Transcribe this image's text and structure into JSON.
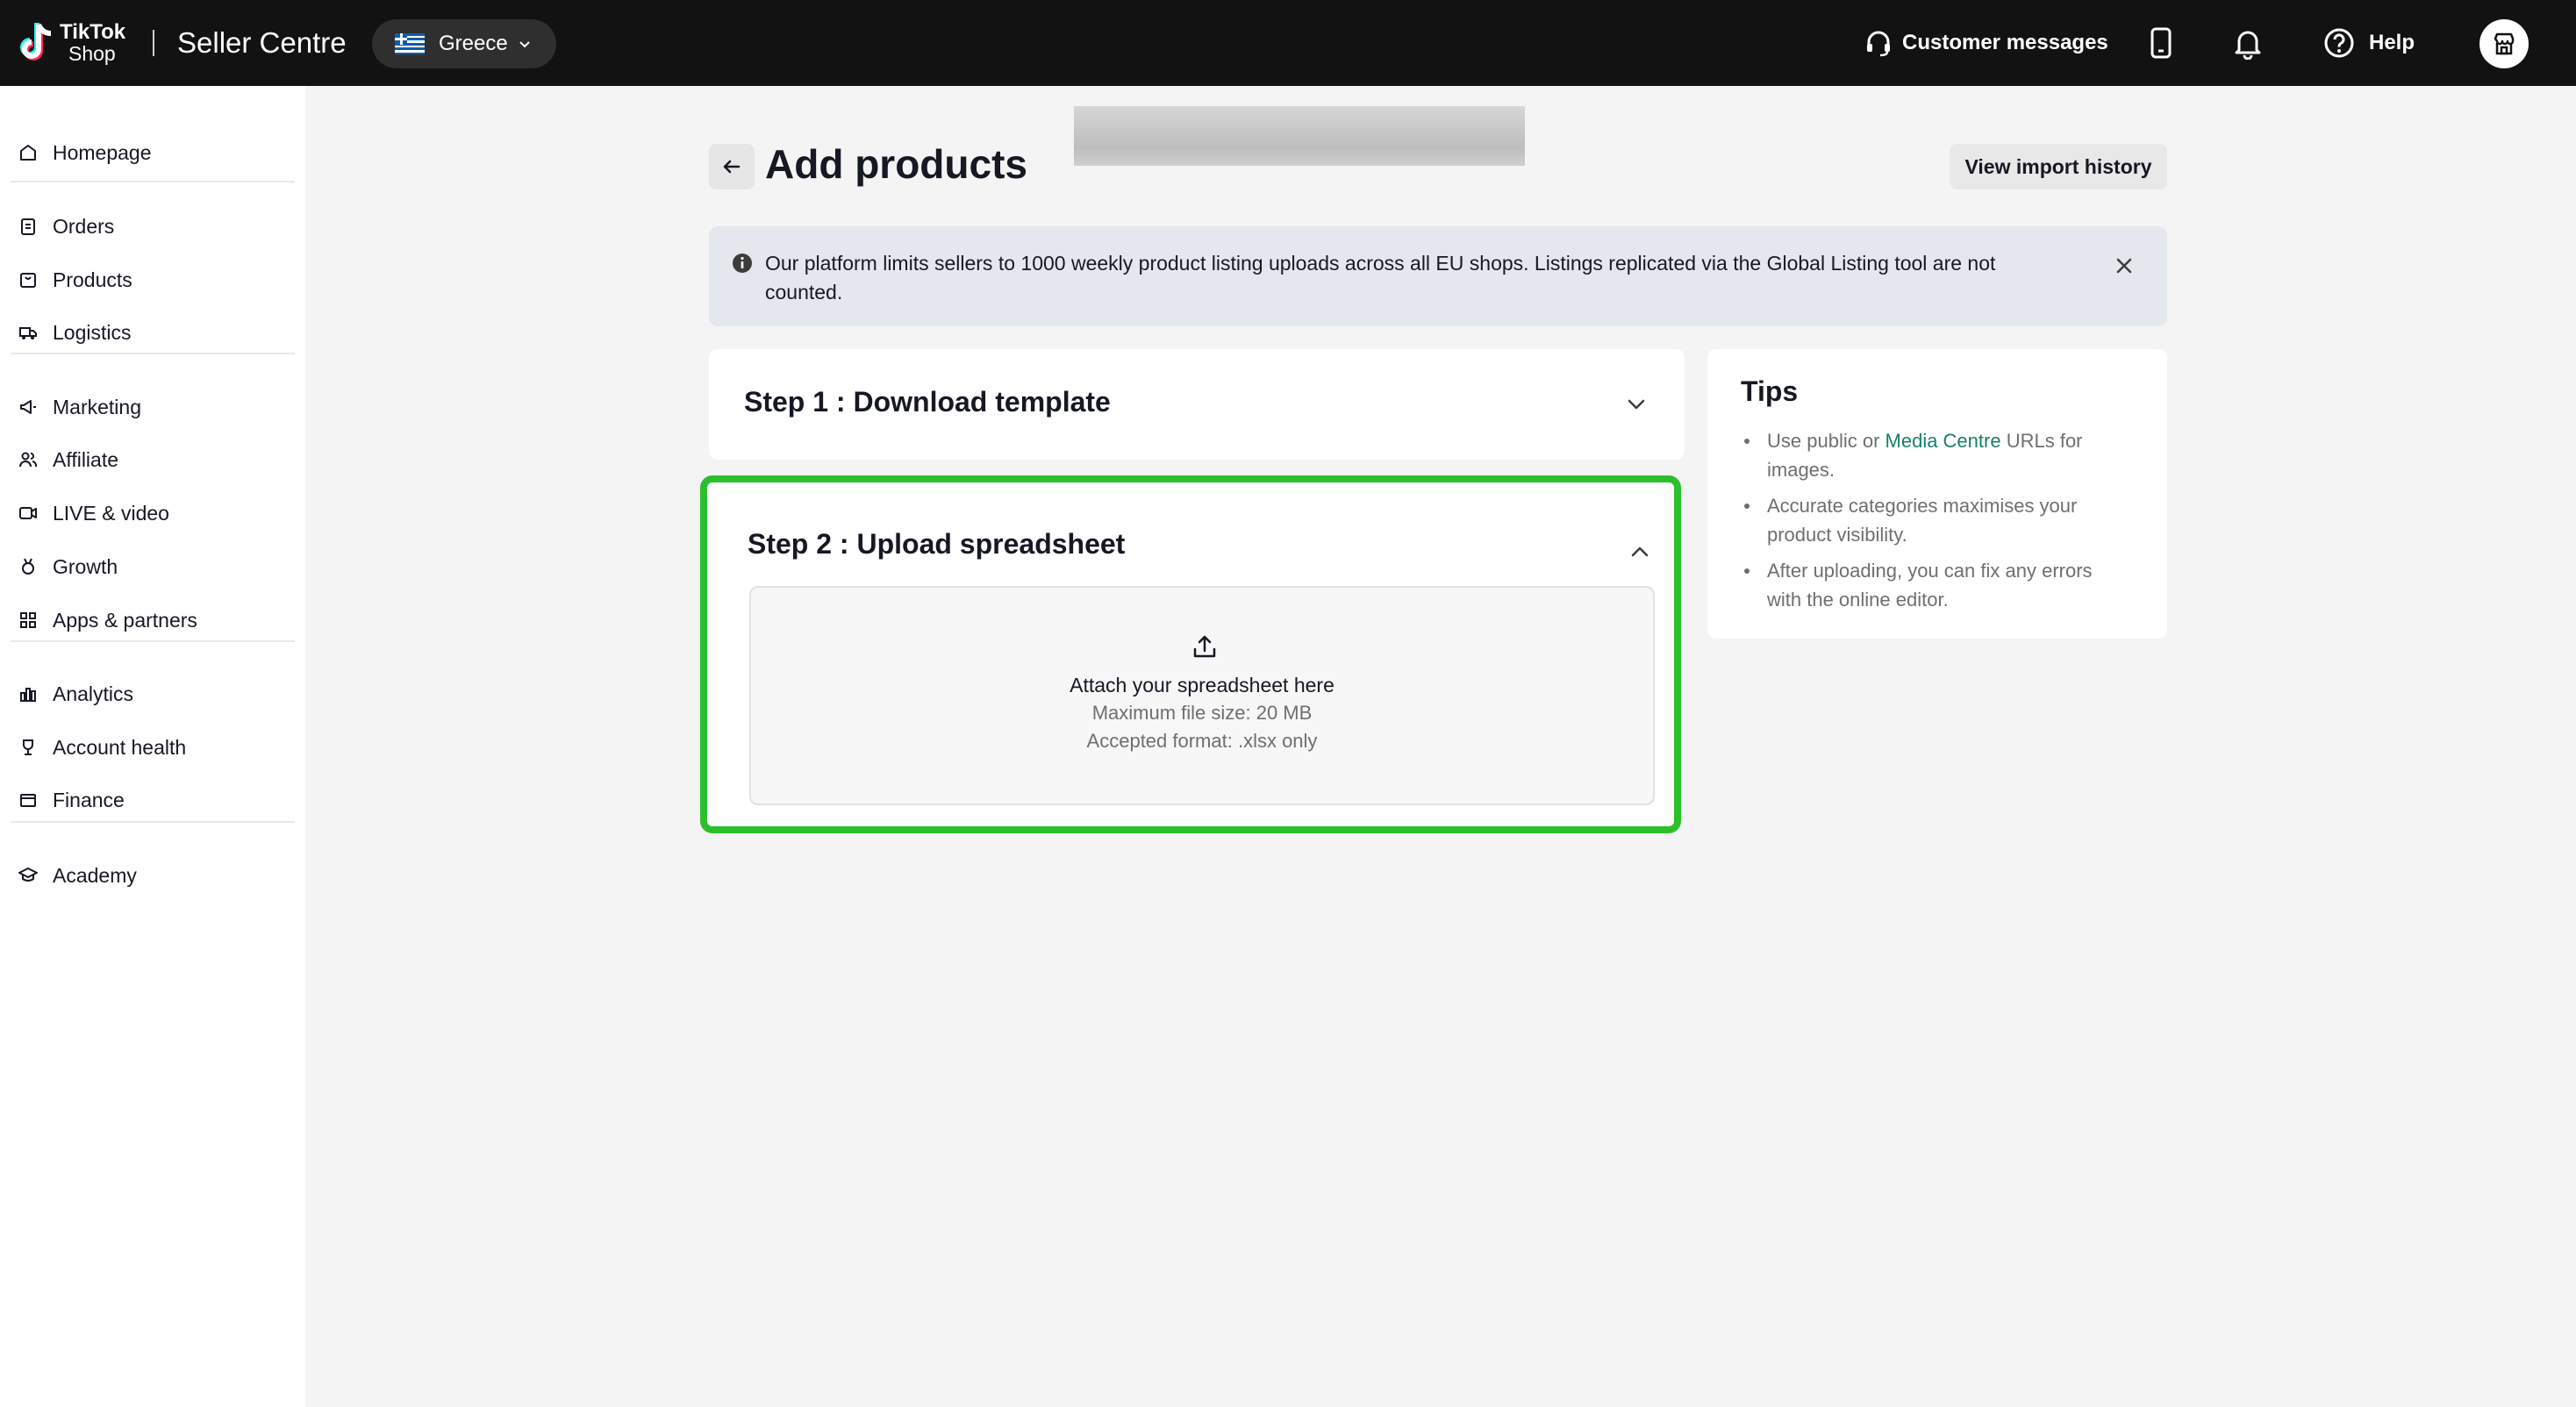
{
  "topbar": {
    "logo_line1": "TikTok",
    "logo_line2": "Shop",
    "app_title": "Seller Centre",
    "region": "Greece",
    "customer_messages": "Customer messages",
    "help": "Help"
  },
  "sidebar": {
    "items": [
      {
        "label": "Homepage",
        "icon": "home-icon"
      },
      {
        "label": "Orders",
        "icon": "clipboard-icon"
      },
      {
        "label": "Products",
        "icon": "box-icon"
      },
      {
        "label": "Logistics",
        "icon": "truck-icon"
      },
      {
        "label": "Marketing",
        "icon": "megaphone-icon"
      },
      {
        "label": "Affiliate",
        "icon": "users-icon"
      },
      {
        "label": "LIVE & video",
        "icon": "video-icon"
      },
      {
        "label": "Growth",
        "icon": "medal-icon"
      },
      {
        "label": "Apps & partners",
        "icon": "grid-icon"
      },
      {
        "label": "Analytics",
        "icon": "chart-icon"
      },
      {
        "label": "Account health",
        "icon": "trophy-icon"
      },
      {
        "label": "Finance",
        "icon": "wallet-icon"
      },
      {
        "label": "Academy",
        "icon": "graduation-cap-icon"
      }
    ]
  },
  "main": {
    "title": "Add products",
    "view_import_history": "View import history",
    "notice": "Our platform limits sellers to 1000 weekly product listing uploads across all EU shops. Listings replicated via the Global Listing tool are not counted.",
    "step1_title": "Step 1 : Download template",
    "step2_title": "Step 2 : Upload spreadsheet",
    "dropzone": {
      "main": "Attach your spreadsheet here",
      "max_size": "Maximum file size: 20 MB",
      "format": "Accepted format: .xlsx only"
    }
  },
  "tips": {
    "title": "Tips",
    "tip1_before": "Use public or ",
    "tip1_link": "Media Centre",
    "tip1_after": " URLs for images.",
    "tip2": "Accurate categories maximises your product visibility.",
    "tip3": "After uploading, you can fix any errors with the online editor."
  },
  "colors": {
    "topbar": "#121212",
    "highlight_border": "#2bc02b",
    "link": "#1a7f6a"
  }
}
